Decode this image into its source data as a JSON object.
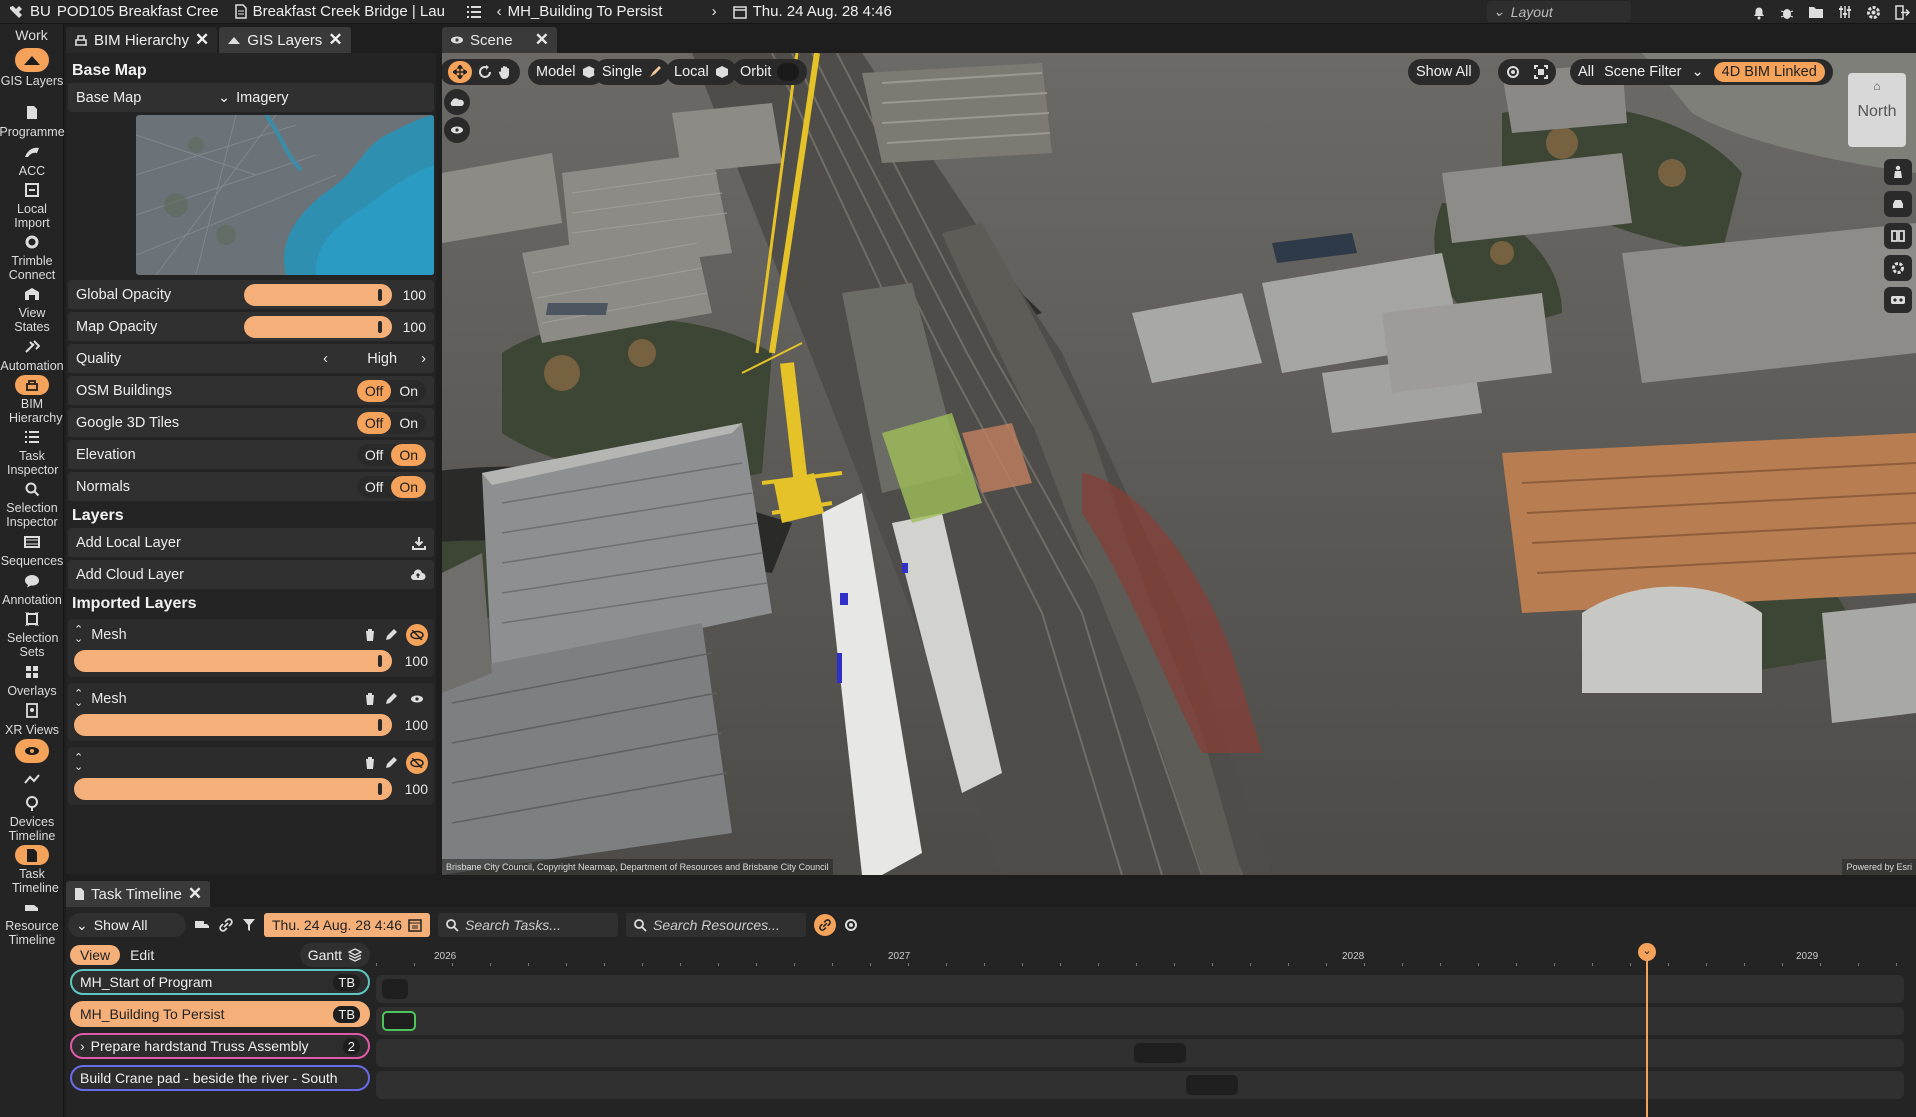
{
  "topbar": {
    "org": "BU",
    "project": "POD105 Breakfast Cree",
    "doc": "Breakfast Creek Bridge | Lau",
    "task_nav": "MH_Building To Persist",
    "datetime": "Thu. 24 Aug. 28 4:46",
    "layout_label": "Layout"
  },
  "rail": {
    "header": "Work",
    "items": [
      {
        "label": "GIS Layers",
        "icon": "layers-icon"
      },
      {
        "label": "Programme",
        "icon": "document-icon"
      },
      {
        "label": "ACC",
        "icon": "acc-icon"
      },
      {
        "label": "Local Import",
        "icon": "import-icon"
      },
      {
        "label": "Trimble Connect",
        "icon": "trimble-icon"
      },
      {
        "label": "View States",
        "icon": "view-states-icon"
      },
      {
        "label": "Automation",
        "icon": "automation-icon"
      },
      {
        "label": "BIM Hierarchy",
        "icon": "bim-icon"
      },
      {
        "label": "Task Inspector",
        "icon": "task-inspector-icon"
      },
      {
        "label": "Selection Inspector",
        "icon": "search-icon"
      },
      {
        "label": "Sequences",
        "icon": "sequences-icon"
      },
      {
        "label": "Annotation",
        "icon": "annotation-icon"
      },
      {
        "label": "Selection Sets",
        "icon": "selection-sets-icon"
      },
      {
        "label": "Overlays",
        "icon": "overlays-icon"
      },
      {
        "label": "XR Views",
        "icon": "xr-icon"
      },
      {
        "label": "Devices Timeline",
        "icon": "devices-icon"
      },
      {
        "label": "Task Timeline",
        "icon": "task-timeline-icon"
      },
      {
        "label": "Resource Timeline",
        "icon": "resource-icon"
      }
    ]
  },
  "panel_tabs": [
    "BIM Hierarchy",
    "GIS Layers"
  ],
  "gis": {
    "base_map_title": "Base Map",
    "base_map_label": "Base Map",
    "base_map_value": "Imagery",
    "global_opacity_label": "Global Opacity",
    "global_opacity_value": "100",
    "map_opacity_label": "Map Opacity",
    "map_opacity_value": "100",
    "quality_label": "Quality",
    "quality_value": "High",
    "osm_label": "OSM Buildings",
    "google_label": "Google 3D Tiles",
    "elevation_label": "Elevation",
    "normals_label": "Normals",
    "off": "Off",
    "on": "On",
    "layers_title": "Layers",
    "add_local": "Add Local Layer",
    "add_cloud": "Add Cloud Layer",
    "imported_title": "Imported Layers",
    "imported": [
      {
        "name": "Mesh",
        "opacity": "100"
      },
      {
        "name": "Mesh",
        "opacity": "100"
      },
      {
        "name": "",
        "opacity": "100"
      }
    ]
  },
  "scene": {
    "tab": "Scene",
    "model": "Model",
    "single": "Single",
    "local": "Local",
    "orbit": "Orbit",
    "show_all": "Show All",
    "all": "All",
    "scene_filter": "Scene Filter",
    "bim_linked": "4D BIM Linked",
    "north": "North",
    "copyright": "Brisbane City Council, Copyright Nearmap, Department of Resources and Brisbane City Council",
    "powered": "Powered by Esri"
  },
  "timeline": {
    "tab": "Task Timeline",
    "show_all": "Show All",
    "date": "Thu. 24 Aug. 28 4:46",
    "search_tasks": "Search Tasks...",
    "search_resources": "Search Resources...",
    "view": "View",
    "edit": "Edit",
    "gantt": "Gantt",
    "years": [
      "2026",
      "2027",
      "2028",
      "2029"
    ],
    "tasks": [
      {
        "name": "MH_Start of Program",
        "badge": "TB",
        "color": "#5ec7c0"
      },
      {
        "name": "MH_Building To Persist",
        "badge": "TB",
        "color": "#f5b07a"
      },
      {
        "name": "Prepare hardstand Truss Assembly",
        "badge": "2",
        "color": "#e05aa8"
      },
      {
        "name": "Build Crane pad - beside the river - South",
        "badge": "",
        "color": "#6a6ae8"
      }
    ]
  },
  "colors": {
    "accent": "#f5a25a",
    "panel": "#242424",
    "slider": "#f5b07a"
  }
}
